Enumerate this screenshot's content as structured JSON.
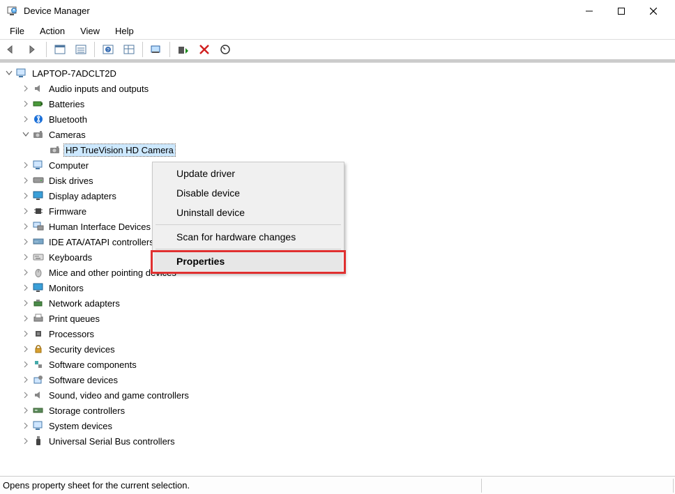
{
  "window": {
    "title": "Device Manager"
  },
  "menubar": {
    "file": "File",
    "action": "Action",
    "view": "View",
    "help": "Help"
  },
  "tree": {
    "root": "LAPTOP-7ADCLT2D",
    "audio": "Audio inputs and outputs",
    "batteries": "Batteries",
    "bluetooth": "Bluetooth",
    "cameras": "Cameras",
    "camera_device": "HP TrueVision HD Camera",
    "computer": "Computer",
    "disk": "Disk drives",
    "display": "Display adapters",
    "firmware": "Firmware",
    "hid": "Human Interface Devices",
    "ide": "IDE ATA/ATAPI controllers",
    "keyboards": "Keyboards",
    "mice": "Mice and other pointing devices",
    "monitors": "Monitors",
    "network": "Network adapters",
    "printq": "Print queues",
    "processors": "Processors",
    "security": "Security devices",
    "softcomp": "Software components",
    "softdev": "Software devices",
    "sound": "Sound, video and game controllers",
    "storage": "Storage controllers",
    "system": "System devices",
    "usb": "Universal Serial Bus controllers"
  },
  "context_menu": {
    "update_driver": "Update driver",
    "disable": "Disable device",
    "uninstall": "Uninstall device",
    "scan": "Scan for hardware changes",
    "properties": "Properties"
  },
  "statusbar": {
    "text": "Opens property sheet for the current selection."
  }
}
